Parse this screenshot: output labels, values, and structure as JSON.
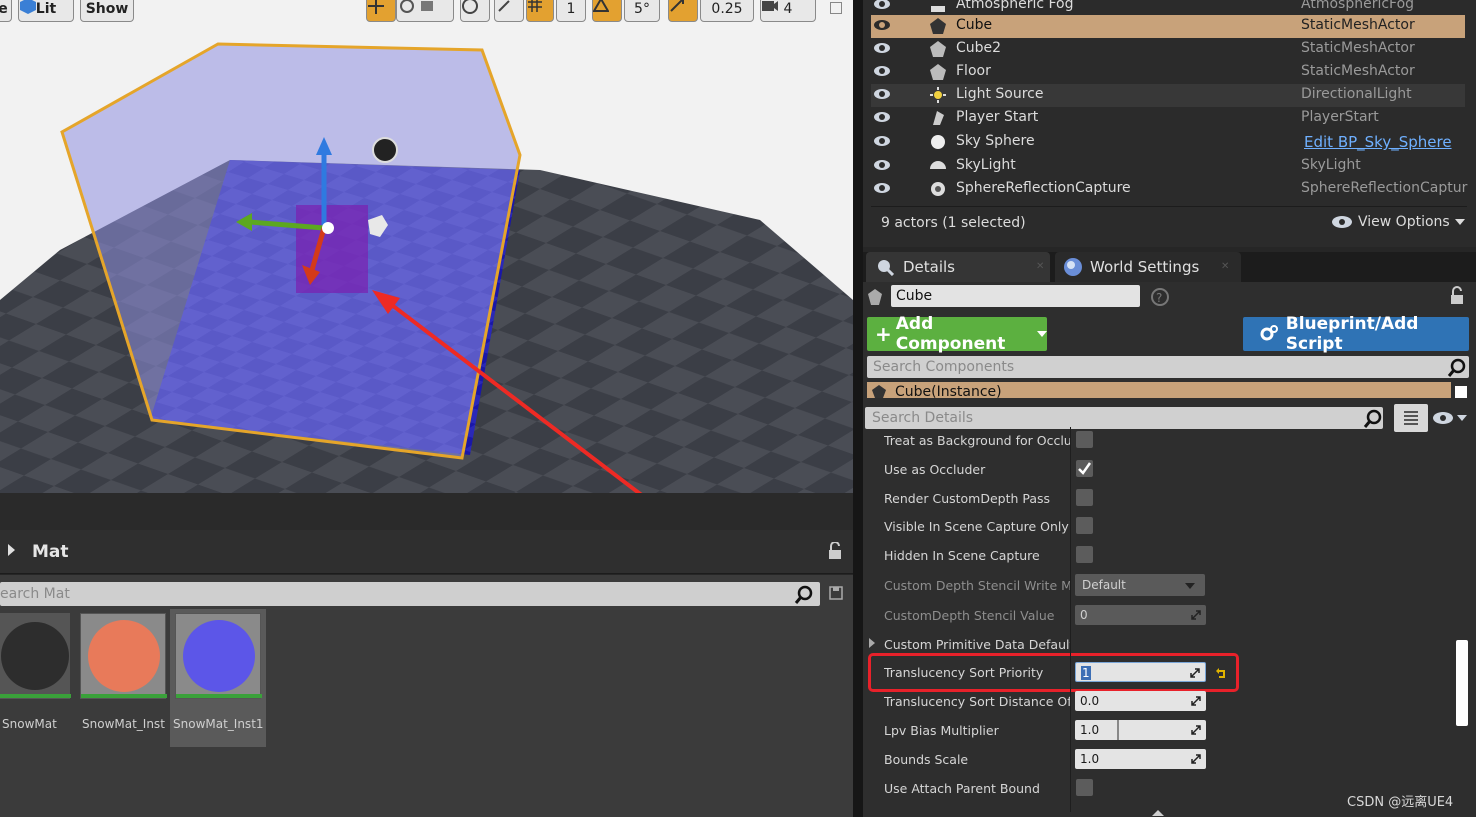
{
  "viewport": {
    "toolbar": {
      "partial_left": "e",
      "lit_label": "Lit",
      "show_label": "Show",
      "grid_value": "1",
      "angle_value": "5°",
      "scale_value": "0.25",
      "camera_value": "4"
    }
  },
  "content_browser": {
    "folder_title": "Mat",
    "search_placeholder": "earch Mat",
    "assets": [
      {
        "label": "SnowMat"
      },
      {
        "label": "SnowMat_Inst"
      },
      {
        "label": "SnowMat_Inst1"
      }
    ]
  },
  "outliner": {
    "rows": [
      {
        "name": "Atmospheric Fog",
        "type": "AtmosphericFog",
        "icon": "fog-icon"
      },
      {
        "name": "Cube",
        "type": "StaticMeshActor",
        "icon": "static-mesh-icon"
      },
      {
        "name": "Cube2",
        "type": "StaticMeshActor",
        "icon": "static-mesh-icon"
      },
      {
        "name": "Floor",
        "type": "StaticMeshActor",
        "icon": "static-mesh-icon"
      },
      {
        "name": "Light Source",
        "type": "DirectionalLight",
        "icon": "sun-icon"
      },
      {
        "name": "Player Start",
        "type": "PlayerStart",
        "icon": "player-start-icon"
      },
      {
        "name": "Sky Sphere",
        "type": "Edit BP_Sky_Sphere",
        "icon": "sphere-icon"
      },
      {
        "name": "SkyLight",
        "type": "SkyLight",
        "icon": "skylight-icon"
      },
      {
        "name": "SphereReflectionCapture",
        "type": "SphereReflectionCaptur",
        "icon": "reflection-icon"
      }
    ],
    "status": "9 actors (1 selected)",
    "view_options": "View Options"
  },
  "details": {
    "tabs": [
      "Details",
      "World Settings"
    ],
    "actor_name": "Cube",
    "add_component_label": "Add Component",
    "blueprint_label": "Blueprint/Add Script",
    "search_components_placeholder": "Search Components",
    "instance_label": "Cube(Instance)",
    "search_details_placeholder": "Search Details",
    "properties": [
      {
        "label": "Treat as Background for Occlusi",
        "kind": "checkbox",
        "checked": false
      },
      {
        "label": "Use as Occluder",
        "kind": "checkbox",
        "checked": true
      },
      {
        "label": "Render CustomDepth Pass",
        "kind": "checkbox",
        "checked": false
      },
      {
        "label": "Visible In Scene Capture Only",
        "kind": "checkbox",
        "checked": false
      },
      {
        "label": "Hidden In Scene Capture",
        "kind": "checkbox",
        "checked": false
      },
      {
        "label": "Custom Depth Stencil Write Mas",
        "kind": "dropdown",
        "value": "Default"
      },
      {
        "label": "CustomDepth Stencil Value",
        "kind": "number",
        "value": "0"
      },
      {
        "label": "Custom Primitive Data Defaults",
        "kind": "group"
      },
      {
        "label": "Translucency Sort Priority",
        "kind": "number",
        "value": "1"
      },
      {
        "label": "Translucency Sort Distance Offs",
        "kind": "number",
        "value": "0.0"
      },
      {
        "label": "Lpv Bias Multiplier",
        "kind": "number",
        "value": "1.0"
      },
      {
        "label": "Bounds Scale",
        "kind": "number",
        "value": "1.0"
      },
      {
        "label": "Use Attach Parent Bound",
        "kind": "checkbox",
        "checked": false
      }
    ]
  },
  "watermark": "CSDN @远离UE4",
  "colors": {
    "selected_row": "#c8a27a",
    "add_component": "#5cb040",
    "blueprint": "#2f73b5",
    "highlight_box": "#e8212a",
    "arrow": "#ee2a24"
  }
}
